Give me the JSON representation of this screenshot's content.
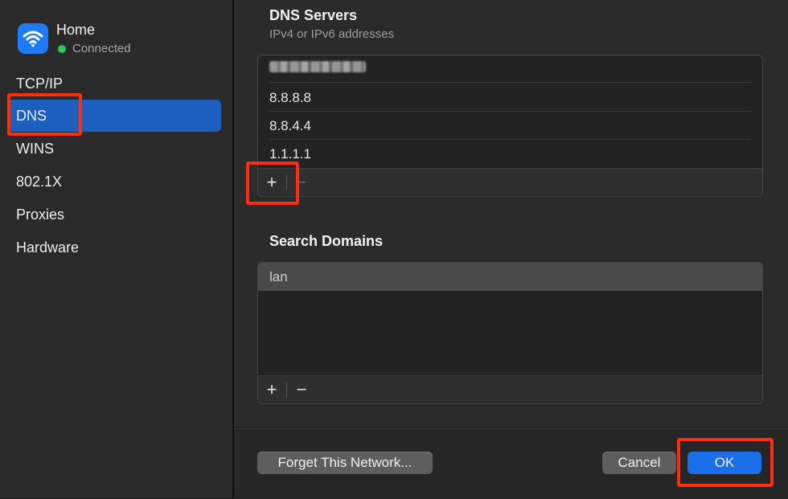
{
  "network": {
    "name": "Home",
    "status": "Connected"
  },
  "sidebar": {
    "items": [
      {
        "label": "TCP/IP",
        "selected": false
      },
      {
        "label": "DNS",
        "selected": true
      },
      {
        "label": "WINS",
        "selected": false
      },
      {
        "label": "802.1X",
        "selected": false
      },
      {
        "label": "Proxies",
        "selected": false
      },
      {
        "label": "Hardware",
        "selected": false
      }
    ]
  },
  "dns": {
    "title": "DNS Servers",
    "subtitle": "IPv4 or IPv6 addresses",
    "servers": [
      "8.8.8.8",
      "8.8.4.4",
      "1.1.1.1"
    ],
    "add_label": "+",
    "remove_label": "−"
  },
  "search_domains": {
    "title": "Search Domains",
    "items": [
      "lan"
    ],
    "add_label": "+",
    "remove_label": "−"
  },
  "footer": {
    "forget_label": "Forget This Network...",
    "cancel_label": "Cancel",
    "ok_label": "OK"
  },
  "colors": {
    "accent": "#1a6ee8",
    "selection": "#1d5fbf",
    "highlight": "#ff2d10",
    "connected": "#32c759"
  },
  "icons": {
    "network": "wifi-icon"
  }
}
